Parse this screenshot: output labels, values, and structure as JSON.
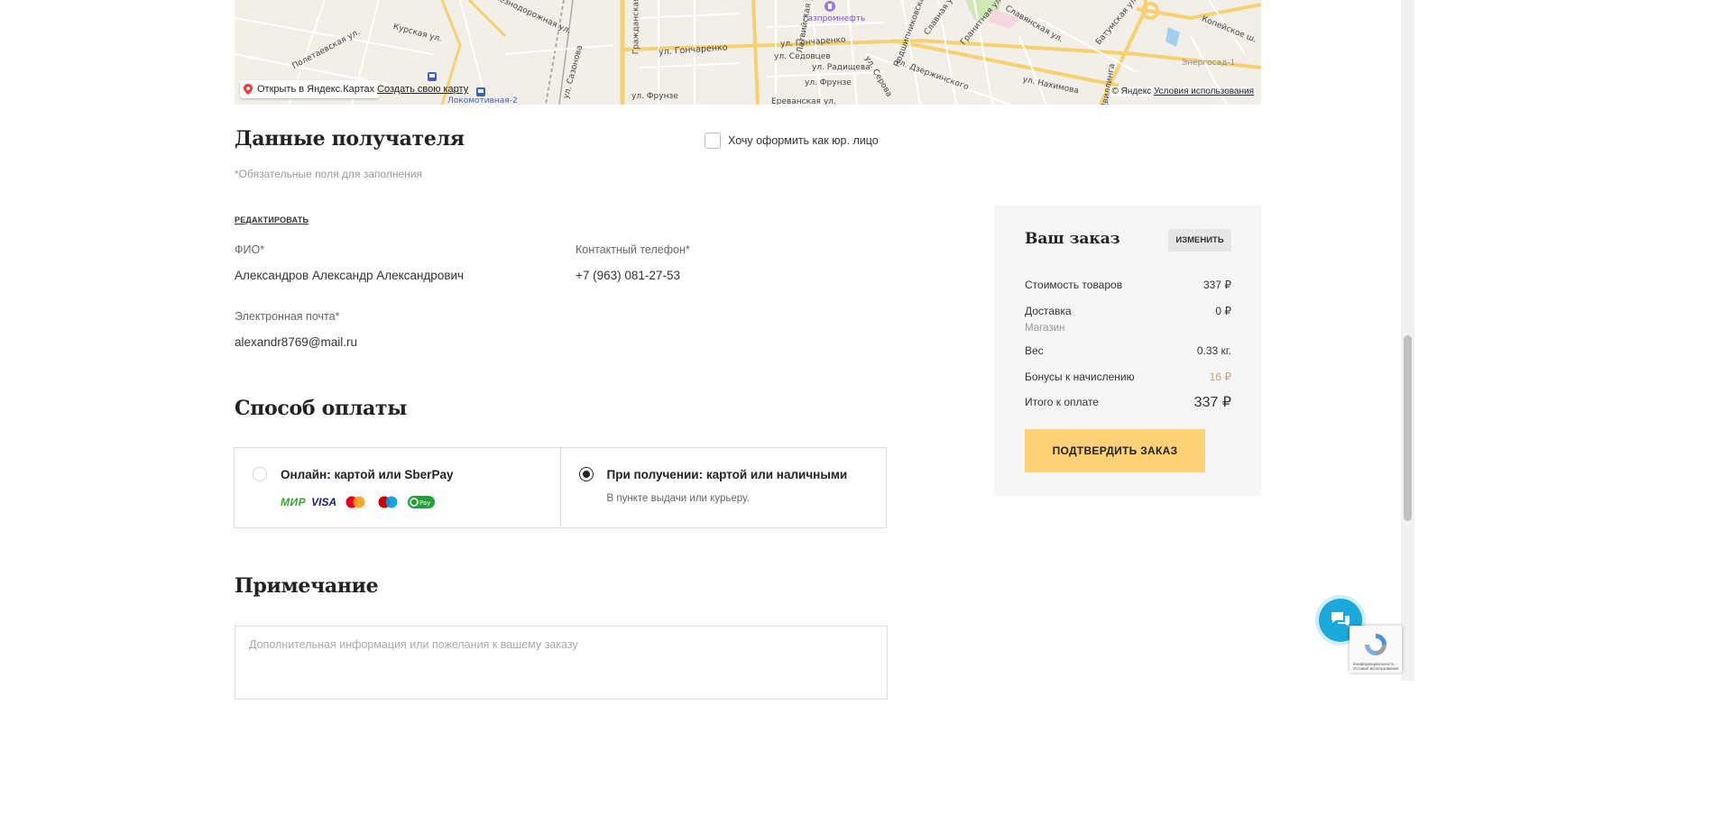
{
  "map": {
    "open_label": "Открыть в Яндекс.Картах",
    "create_label": "Создать свою карту",
    "copyright": "© Яндекс",
    "terms_label": "Условия использования",
    "labels": [
      "Полетаевская ул.",
      "Курская ул.",
      "Железнодорожная ул.",
      "ул. Гончаренко",
      "ул. Гончаренко",
      "ул. Седовцев",
      "ул. Радищева",
      "ул. Фрунзе",
      "ул. Фрунзе",
      "ул. Дзержинского",
      "ул. Нахимова",
      "Газпромнефть",
      "Энергосад-1",
      "Копейское ш.",
      "Славянская ул.",
      "Гранитная ул.",
      "Батумская ул.",
      "Славная ул.",
      "Латвийская ул.",
      "Локомотивная-2",
      "ул. Сазонова",
      "Гражданская ул.",
      "ул. Серова",
      "Подшипниковская ул.",
      "Ереванская ул.",
      "ул.Цвиллинга"
    ]
  },
  "recipient": {
    "title": "Данные получателя",
    "legal_checkbox_label": "Хочу оформить как юр. лицо",
    "required_note": "*Обязательные поля для заполнения",
    "edit_label": "редактировать",
    "fio_label": "ФИО*",
    "fio_value": "Александров Александр Александрович",
    "phone_label": "Контактный телефон*",
    "phone_value": "+7 (963) 081-27-53",
    "email_label": "Электронная почта*",
    "email_value": "alexandr8769@mail.ru"
  },
  "payment": {
    "title": "Способ оплаты",
    "options": [
      {
        "label": "Онлайн: картой или SberPay",
        "selected": false,
        "cards": [
          "МИР",
          "VISA",
          "Mastercard",
          "Maestro",
          "SberPay"
        ]
      },
      {
        "label": "При получении: картой или наличными",
        "sublabel": "В пункте выдачи или курьеру.",
        "selected": true
      }
    ]
  },
  "note": {
    "title": "Примечание",
    "placeholder": "Дополнительная информация или пожелания к вашему заказу"
  },
  "order": {
    "title": "Ваш заказ",
    "edit_label": "изменить",
    "rows": {
      "goods_label": "Стоимость товаров",
      "goods_value": "337 ₽",
      "delivery_label": "Доставка",
      "delivery_value": "0 ₽",
      "delivery_sub": "Магазин",
      "weight_label": "Вес",
      "weight_value": "0.33 кг.",
      "bonus_label": "Бонусы к начислению",
      "bonus_value": "16 ₽",
      "total_label": "Итого к оплате",
      "total_value": "337 ₽"
    },
    "confirm_label": "Подтвердить заказ"
  },
  "recaptcha_text": "Конфиденциальность - Условия использования",
  "colors": {
    "accent": "#fdd276",
    "chat": "#1aa9d8",
    "bonus": "#c0a080"
  }
}
